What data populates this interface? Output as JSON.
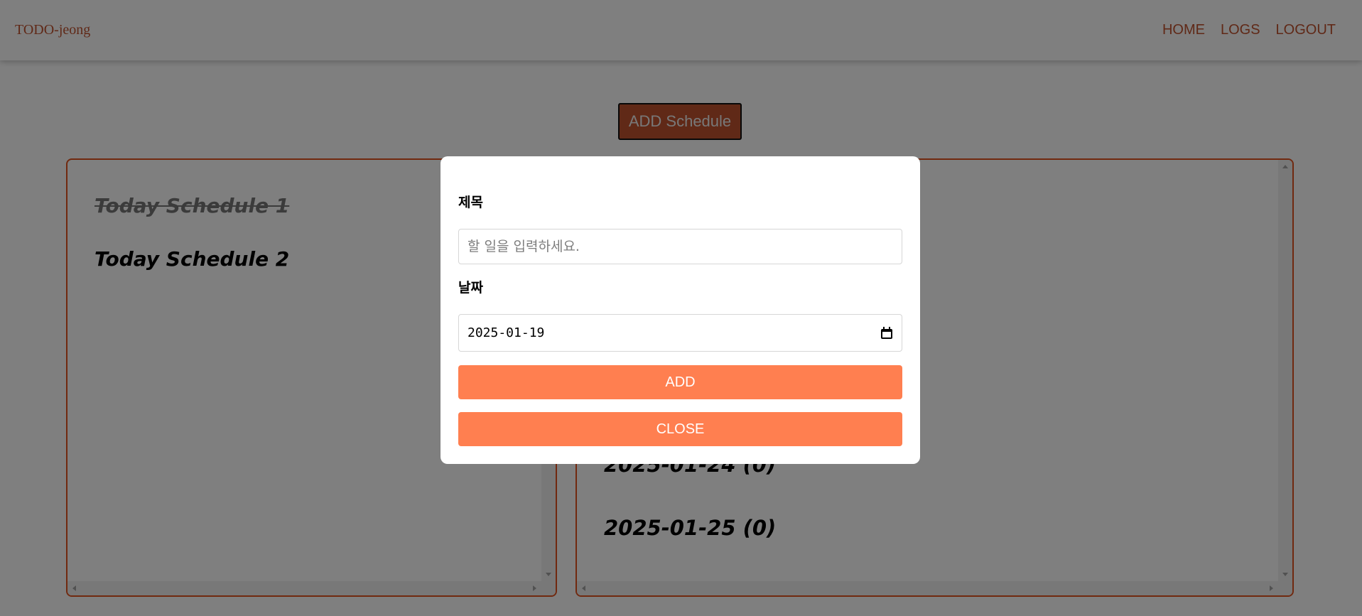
{
  "navbar": {
    "brand": "TODO-jeong",
    "links": [
      "HOME",
      "LOGS",
      "LOGOUT"
    ]
  },
  "toolbar": {
    "add_schedule_label": "ADD Schedule"
  },
  "today_panel": {
    "items": [
      {
        "label": "Today Schedule 1",
        "done": true
      },
      {
        "label": "Today Schedule 2",
        "done": false
      }
    ]
  },
  "upcoming_panel": {
    "visible_dates": [
      "2025-01-24 (0)",
      "2025-01-25 (0)"
    ]
  },
  "modal": {
    "title_label": "제목",
    "title_placeholder": "할 일을 입력하세요.",
    "date_label": "날짜",
    "date_value": "2025-01-19",
    "add_label": "ADD",
    "close_label": "CLOSE"
  },
  "colors": {
    "accent": "#c0522f",
    "panel_border": "#e2531f",
    "button": "#ff7f50"
  }
}
